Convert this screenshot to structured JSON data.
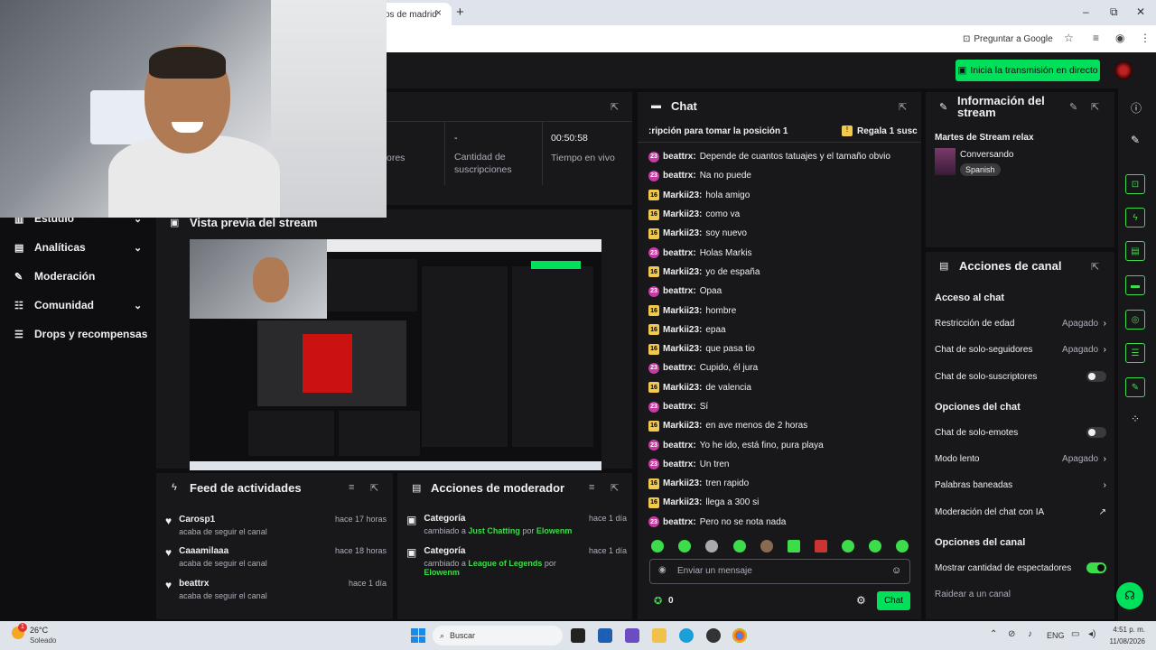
{
  "browser": {
    "tab_title": "os de madrid",
    "tab_close": "×",
    "new_tab": "+",
    "google_button": "Preguntar a Google",
    "win_min": "–",
    "win_max": "⧉",
    "win_close": "✕"
  },
  "topbar": {
    "go_live": "Inicia la transmisión en directo"
  },
  "nav": {
    "items": [
      {
        "label": "Estudio",
        "icon": "studio-icon"
      },
      {
        "label": "Analíticas",
        "icon": "analytics-icon"
      },
      {
        "label": "Moderación",
        "icon": "wrench-icon"
      },
      {
        "label": "Comunidad",
        "icon": "community-icon"
      },
      {
        "label": "Drops y recompensas",
        "icon": "drops-icon"
      }
    ]
  },
  "stats": {
    "viewers_label_partial": "ores",
    "subs_value": "-",
    "subs_label": "Cantidad de suscripciones",
    "live_time": "00:50:58",
    "live_time_label": "Tiempo en vivo"
  },
  "preview": {
    "title": "Vista previa del stream"
  },
  "feed": {
    "title": "Feed de actividades",
    "items": [
      {
        "name": "Carosp1",
        "sub": "acaba de seguir el canal",
        "time": "hace 17 horas"
      },
      {
        "name": "Caaamilaaa",
        "sub": "acaba de seguir el canal",
        "time": "hace 18 horas"
      },
      {
        "name": "beattrx",
        "sub": "acaba de seguir el canal",
        "time": "hace 1 día"
      }
    ]
  },
  "modactions": {
    "title": "Acciones de moderador",
    "items": [
      {
        "name": "Categoría",
        "pre": "cambiado a ",
        "game": "Just Chatting",
        "mid": " por ",
        "by": "Elowenm",
        "time": "hace 1 día"
      },
      {
        "name": "Categoría",
        "pre": "cambiado a ",
        "game": "League of Legends",
        "mid": " por ",
        "by": "Elowenm",
        "time": "hace 1 día"
      }
    ]
  },
  "chat": {
    "title": "Chat",
    "banner_left": ":ripción para tomar la posición 1",
    "banner_right": "Regala 1 susc",
    "messages": [
      {
        "badge": "23",
        "user": "beattrx:",
        "text": "Depende de cuantos tatuajes y el tamaño obvio"
      },
      {
        "badge": "23",
        "user": "beattrx:",
        "text": "Na no puede"
      },
      {
        "badge": "16",
        "user": "Markii23:",
        "text": "hola amigo"
      },
      {
        "badge": "16",
        "user": "Markii23:",
        "text": "como va"
      },
      {
        "badge": "16",
        "user": "Markii23:",
        "text": "soy nuevo"
      },
      {
        "badge": "23",
        "user": "beattrx:",
        "text": "Holas Markis"
      },
      {
        "badge": "16",
        "user": "Markii23:",
        "text": "yo de españa"
      },
      {
        "badge": "23",
        "user": "beattrx:",
        "text": "Opaa"
      },
      {
        "badge": "16",
        "user": "Markii23:",
        "text": "hombre"
      },
      {
        "badge": "16",
        "user": "Markii23:",
        "text": "epaa"
      },
      {
        "badge": "16",
        "user": "Markii23:",
        "text": "que pasa tio"
      },
      {
        "badge": "23",
        "user": "beattrx:",
        "text": "Cupido, él jura"
      },
      {
        "badge": "16",
        "user": "Markii23:",
        "text": "de valencia"
      },
      {
        "badge": "23",
        "user": "beattrx:",
        "text": "Sí"
      },
      {
        "badge": "16",
        "user": "Markii23:",
        "text": "en ave menos de 2 horas"
      },
      {
        "badge": "23",
        "user": "beattrx:",
        "text": "Yo he ido, está fino, pura playa"
      },
      {
        "badge": "23",
        "user": "beattrx:",
        "text": "Un tren"
      },
      {
        "badge": "16",
        "user": "Markii23:",
        "text": "tren rapido"
      },
      {
        "badge": "16",
        "user": "Markii23:",
        "text": "llega a 300 si"
      },
      {
        "badge": "23",
        "user": "beattrx:",
        "text": "Pero no se nota nada"
      }
    ],
    "input_placeholder": "Enviar un mensaje",
    "points": "0",
    "send": "Chat"
  },
  "info": {
    "title": "Información del stream",
    "stream_title": "Martes de Stream relax",
    "category": "Conversando",
    "tag": "Spanish"
  },
  "channel": {
    "title": "Acciones de canal",
    "chat_access": "Acceso al chat",
    "age": {
      "label": "Restricción de edad",
      "value": "Apagado"
    },
    "followers": {
      "label": "Chat de solo-seguidores",
      "value": "Apagado"
    },
    "subs_only": "Chat de solo-suscriptores",
    "chat_options": "Opciones del chat",
    "emotes_only": "Chat de solo-emotes",
    "slow": {
      "label": "Modo lento",
      "value": "Apagado"
    },
    "banned_words": "Palabras baneadas",
    "ai_mod": "Moderación del chat con IA",
    "channel_options": "Opciones del canal",
    "show_viewers": "Mostrar cantidad de espectadores",
    "raid": "Raidear a un canal"
  },
  "taskbar": {
    "weather_temp": "26°C",
    "weather_desc": "Soleado",
    "search": "Buscar",
    "lang": "ENG",
    "time": "4:51 p. m.",
    "date": "11/08/2026",
    "notif_count": "1"
  }
}
